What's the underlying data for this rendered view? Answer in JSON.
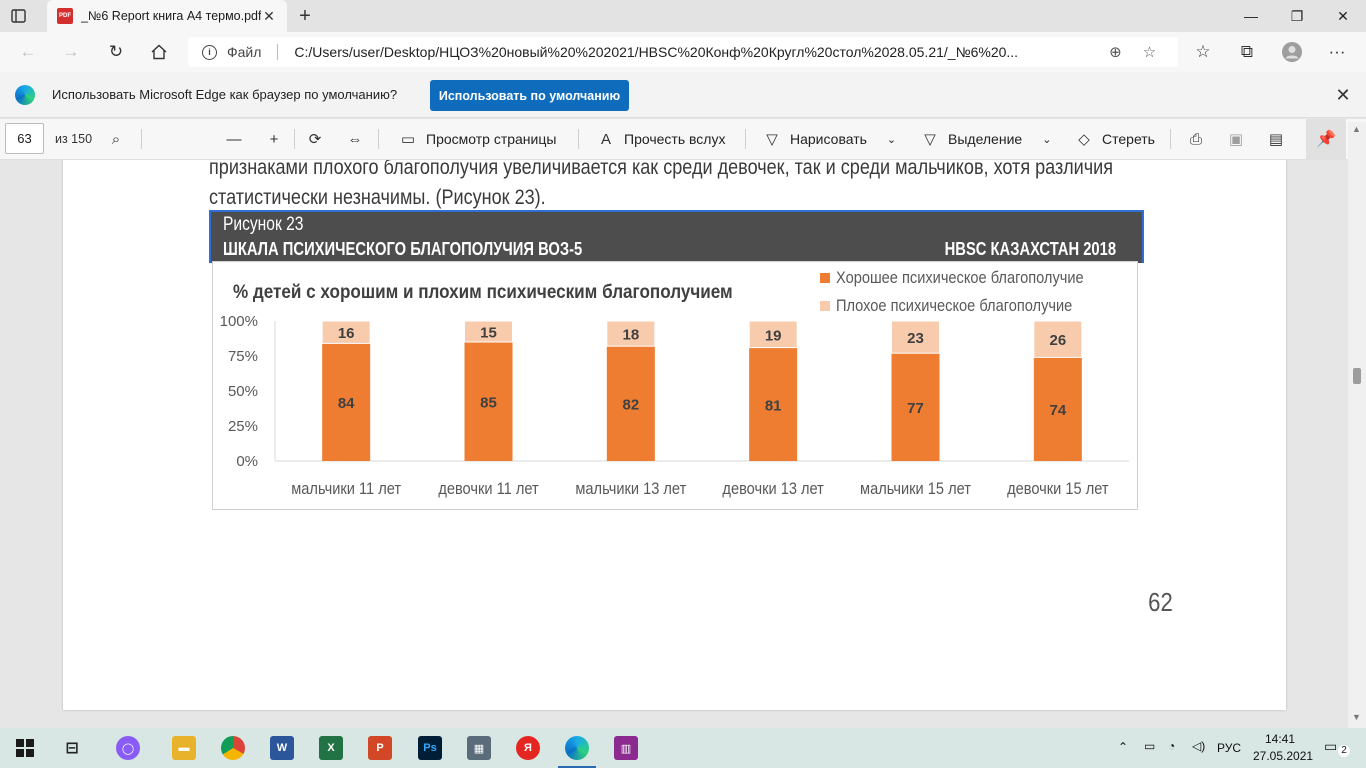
{
  "browser": {
    "tab_title": "_№6 Report книга А4 термо.pdf",
    "tab_favicon": "PDF",
    "address_label": "Файл",
    "url": "C:/Users/user/Desktop/НЦОЗ%20новый%20%202021/HBSC%20Конф%20Кругл%20стол%2028.05.21/_№6%20..."
  },
  "infobar": {
    "message": "Использовать Microsoft Edge как браузер по умолчанию?",
    "button_label": "Использовать по умолчанию"
  },
  "pdf_toolbar": {
    "page_current": "63",
    "page_total": "из 150",
    "page_view_label": "Просмотр страницы",
    "read_aloud_label": "Прочесть вслух",
    "draw_label": "Нарисовать",
    "highlight_label": "Выделение",
    "erase_label": "Стереть"
  },
  "document": {
    "text_line_1": "признаками плохого благополучия увеличивается как среди девочек, так и среди мальчиков, хотя различия",
    "text_line_2": "статистически незначимы. (Рисунок 23).",
    "figure_caption": "Рисунок 23",
    "figure_title": "ШКАЛА ПСИХИЧЕСКОГО БЛАГОПОЛУЧИЯ ВОЗ-5",
    "figure_source": "HBSC КАЗАХСТАН 2018",
    "page_number": "62"
  },
  "chart_data": {
    "type": "bar",
    "stacked": true,
    "title": "% детей с хорошим и плохим психическим благополучием",
    "categories": [
      "мальчики 11 лет",
      "девочки 11 лет",
      "мальчики 13 лет",
      "девочки 13 лет",
      "мальчики 15 лет",
      "девочки 15 лет"
    ],
    "series": [
      {
        "name": "Хорошее психическое благополучие",
        "values": [
          84,
          85,
          82,
          81,
          77,
          74
        ],
        "color": "#ee7d31"
      },
      {
        "name": "Плохое психическое благополучие",
        "values": [
          16,
          15,
          18,
          19,
          23,
          26
        ],
        "color": "#f8cbad"
      }
    ],
    "yticks": [
      "0%",
      "25%",
      "50%",
      "75%",
      "100%"
    ],
    "ylim": [
      0,
      100
    ],
    "legend": "top-right",
    "grid": false
  },
  "taskbar": {
    "lang": "РУС",
    "time": "14:41",
    "date": "27.05.2021",
    "notifications": "2"
  }
}
